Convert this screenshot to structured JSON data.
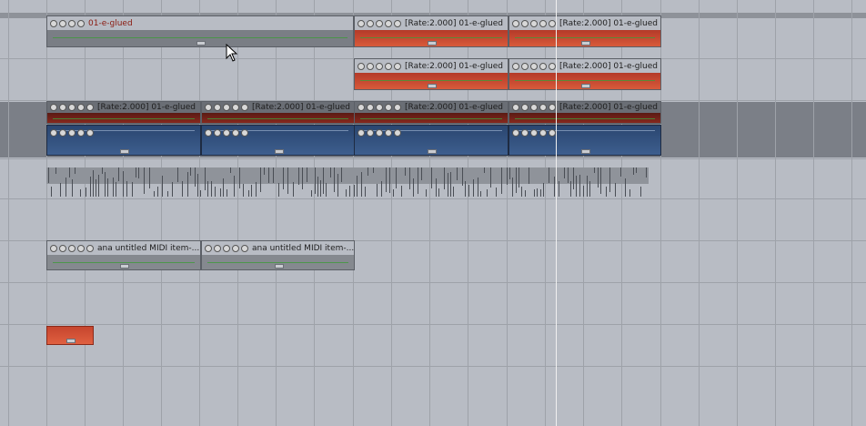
{
  "items": {
    "glued": "01-e-glued",
    "rate_glued": "[Rate:2.000] 01-e-glued",
    "midi": "ana untitled MIDI item-..."
  },
  "colors": {
    "background": "#b8bcc4",
    "item_grey": "#7a7e85",
    "item_red": "#c84830",
    "item_blue": "#2f4d7a",
    "selected_track": "#7b7f87",
    "play_cursor": "#f0f0f0",
    "waveform": "#3f9a3a"
  },
  "icons": [
    "mute-icon",
    "lock-icon",
    "fx-icon",
    "envelope-icon",
    "take-icon",
    "mouse-cursor-icon"
  ]
}
